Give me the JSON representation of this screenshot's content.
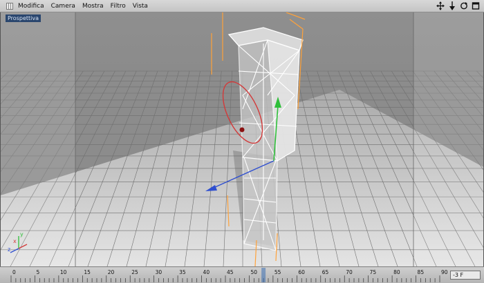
{
  "menubar": {
    "items": [
      "Modifica",
      "Camera",
      "Mostra",
      "Filtro",
      "Vista"
    ],
    "nav_icons": [
      "move-view-icon",
      "zoom-view-icon",
      "rotate-view-icon",
      "maximize-view-icon"
    ]
  },
  "viewport": {
    "label": "Prospettiva",
    "axis_labels": {
      "x": "x",
      "y": "y",
      "z": "z"
    }
  },
  "timeline": {
    "ticks": [
      "0",
      "5",
      "10",
      "15",
      "20",
      "25",
      "30",
      "35",
      "40",
      "45",
      "50",
      "55",
      "60",
      "65",
      "70",
      "75",
      "80",
      "85",
      "90"
    ],
    "current_frame": "53 F",
    "frame_field": "-3 F"
  },
  "colors": {
    "grid_floor": "#9a9a9a",
    "object_wire": "#ffffff",
    "selection": "#ffa23a",
    "axis_x": "#d23a3a",
    "axis_y": "#2fbf3a",
    "axis_z": "#2f4fd0",
    "view_label_bg": "#2a466e"
  }
}
